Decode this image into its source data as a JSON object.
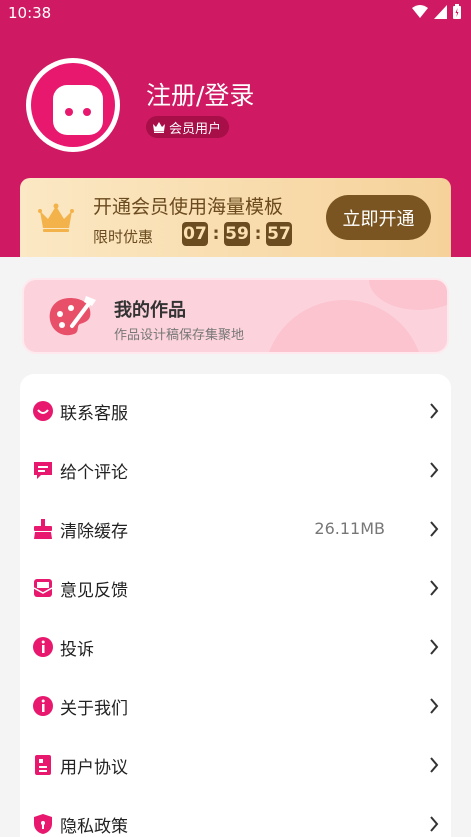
{
  "status": {
    "time": "10:38"
  },
  "profile": {
    "login_label": "注册/登录",
    "member_label": "会员用户"
  },
  "vip": {
    "title": "开通会员使用海量模板",
    "promo_label": "限时优惠",
    "countdown": {
      "h": "07",
      "m": "59",
      "s": "57"
    },
    "button_label": "立即开通"
  },
  "works": {
    "title": "我的作品",
    "subtitle": "作品设计稿保存集聚地"
  },
  "menu": {
    "items": [
      {
        "label": "联系客服",
        "value": "",
        "icon": "chat-icon"
      },
      {
        "label": "给个评论",
        "value": "",
        "icon": "comment-icon"
      },
      {
        "label": "清除缓存",
        "value": "26.11MB",
        "icon": "broom-icon"
      },
      {
        "label": "意见反馈",
        "value": "",
        "icon": "mail-icon"
      },
      {
        "label": "投诉",
        "value": "",
        "icon": "info-icon"
      },
      {
        "label": "关于我们",
        "value": "",
        "icon": "info-icon"
      },
      {
        "label": "用户协议",
        "value": "",
        "icon": "document-icon"
      },
      {
        "label": "隐私政策",
        "value": "",
        "icon": "shield-icon"
      }
    ]
  },
  "colors": {
    "brand": "#cf1a63",
    "icon_pink": "#e8186e",
    "gold_dark": "#7a5522"
  }
}
